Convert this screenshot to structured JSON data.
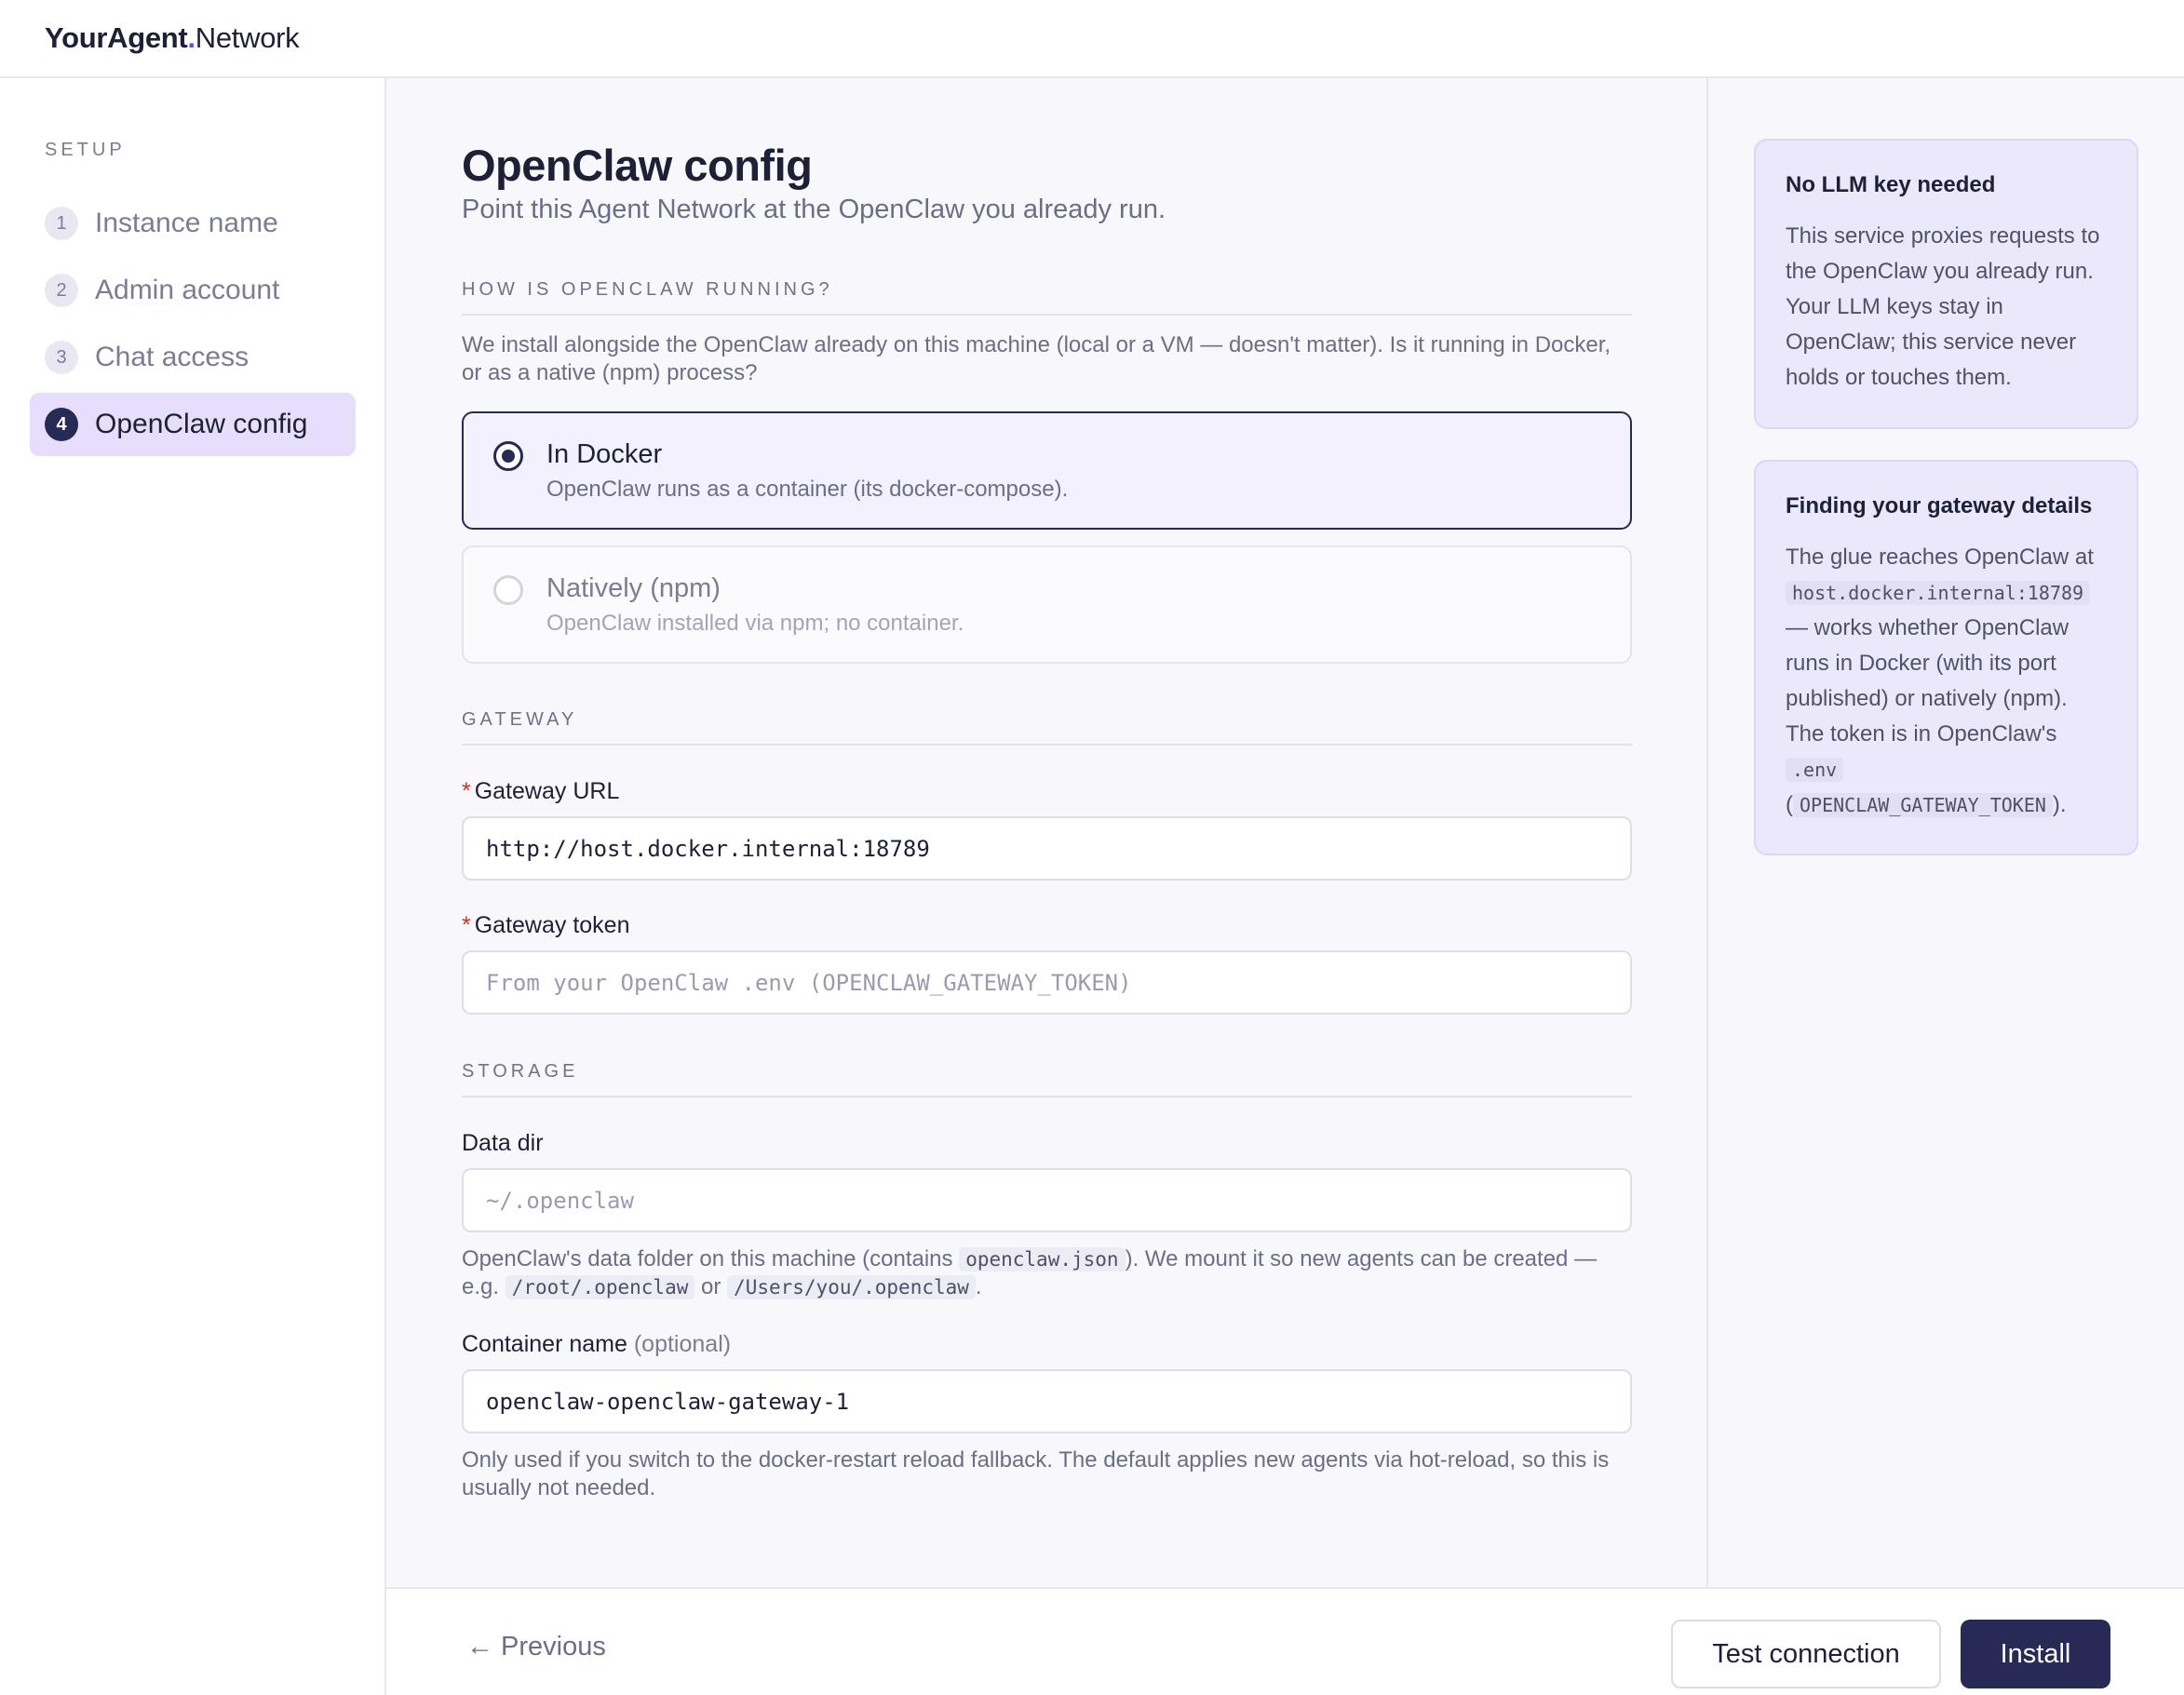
{
  "brand": {
    "name_bold": "YourAgent",
    "dot": ".",
    "name_rest": "Network"
  },
  "sidebar": {
    "title": "SETUP",
    "steps": [
      {
        "num": "1",
        "label": "Instance name"
      },
      {
        "num": "2",
        "label": "Admin account"
      },
      {
        "num": "3",
        "label": "Chat access"
      },
      {
        "num": "4",
        "label": "OpenClaw config"
      }
    ],
    "active_step": 4
  },
  "main": {
    "title": "OpenClaw config",
    "subtitle": "Point this Agent Network at the OpenClaw you already run.",
    "running": {
      "heading": "HOW IS OPENCLAW RUNNING?",
      "description": "We install alongside the OpenClaw already on this machine (local or a VM — doesn't matter). Is it running in Docker, or as a native (npm) process?",
      "options": [
        {
          "title": "In Docker",
          "desc": "OpenClaw runs as a container (its docker-compose).",
          "selected": true
        },
        {
          "title": "Natively (npm)",
          "desc": "OpenClaw installed via npm; no container.",
          "selected": false
        }
      ]
    },
    "gateway": {
      "heading": "GATEWAY",
      "url_label": "Gateway URL",
      "url_value": "http://host.docker.internal:18789",
      "token_label": "Gateway token",
      "token_placeholder": "From your OpenClaw .env (OPENCLAW_GATEWAY_TOKEN)",
      "required_mark": "*"
    },
    "storage": {
      "heading": "STORAGE",
      "datadir_label": "Data dir",
      "datadir_placeholder": "~/.openclaw",
      "datadir_help_1": "OpenClaw's data folder on this machine (contains ",
      "datadir_help_code1": "openclaw.json",
      "datadir_help_2": "). We mount it so new agents can be created — e.g. ",
      "datadir_help_code2": "/root/.openclaw",
      "datadir_help_3": " or ",
      "datadir_help_code3": "/Users/you/.openclaw",
      "datadir_help_4": ".",
      "container_label": "Container name",
      "container_optional": "(optional)",
      "container_value": "openclaw-openclaw-gateway-1",
      "container_help": "Only used if you switch to the docker-restart reload fallback. The default applies new agents via hot-reload, so this is usually not needed."
    }
  },
  "aside": {
    "card1": {
      "title": "No LLM key needed",
      "body": "This service proxies requests to the OpenClaw you already run. Your LLM keys stay in OpenClaw; this service never holds or touches them."
    },
    "card2": {
      "title": "Finding your gateway details",
      "body_1": "The glue reaches OpenClaw at",
      "code_1": "host.docker.internal:18789",
      "body_2": "— works whether OpenClaw runs in Docker (with its port published) or natively (npm). The token is in OpenClaw's",
      "code_2": ".env",
      "body_3": "(",
      "code_3": "OPENCLAW_GATEWAY_TOKEN",
      "body_4": ")."
    }
  },
  "footer": {
    "prev_arrow": "←",
    "prev_label": "Previous",
    "test_label": "Test connection",
    "install_label": "Install"
  },
  "colors": {
    "accent": "#262a55",
    "active_step_bg": "#e6defb",
    "info_card_bg": "#ece8fb",
    "required": "#c0392b"
  }
}
